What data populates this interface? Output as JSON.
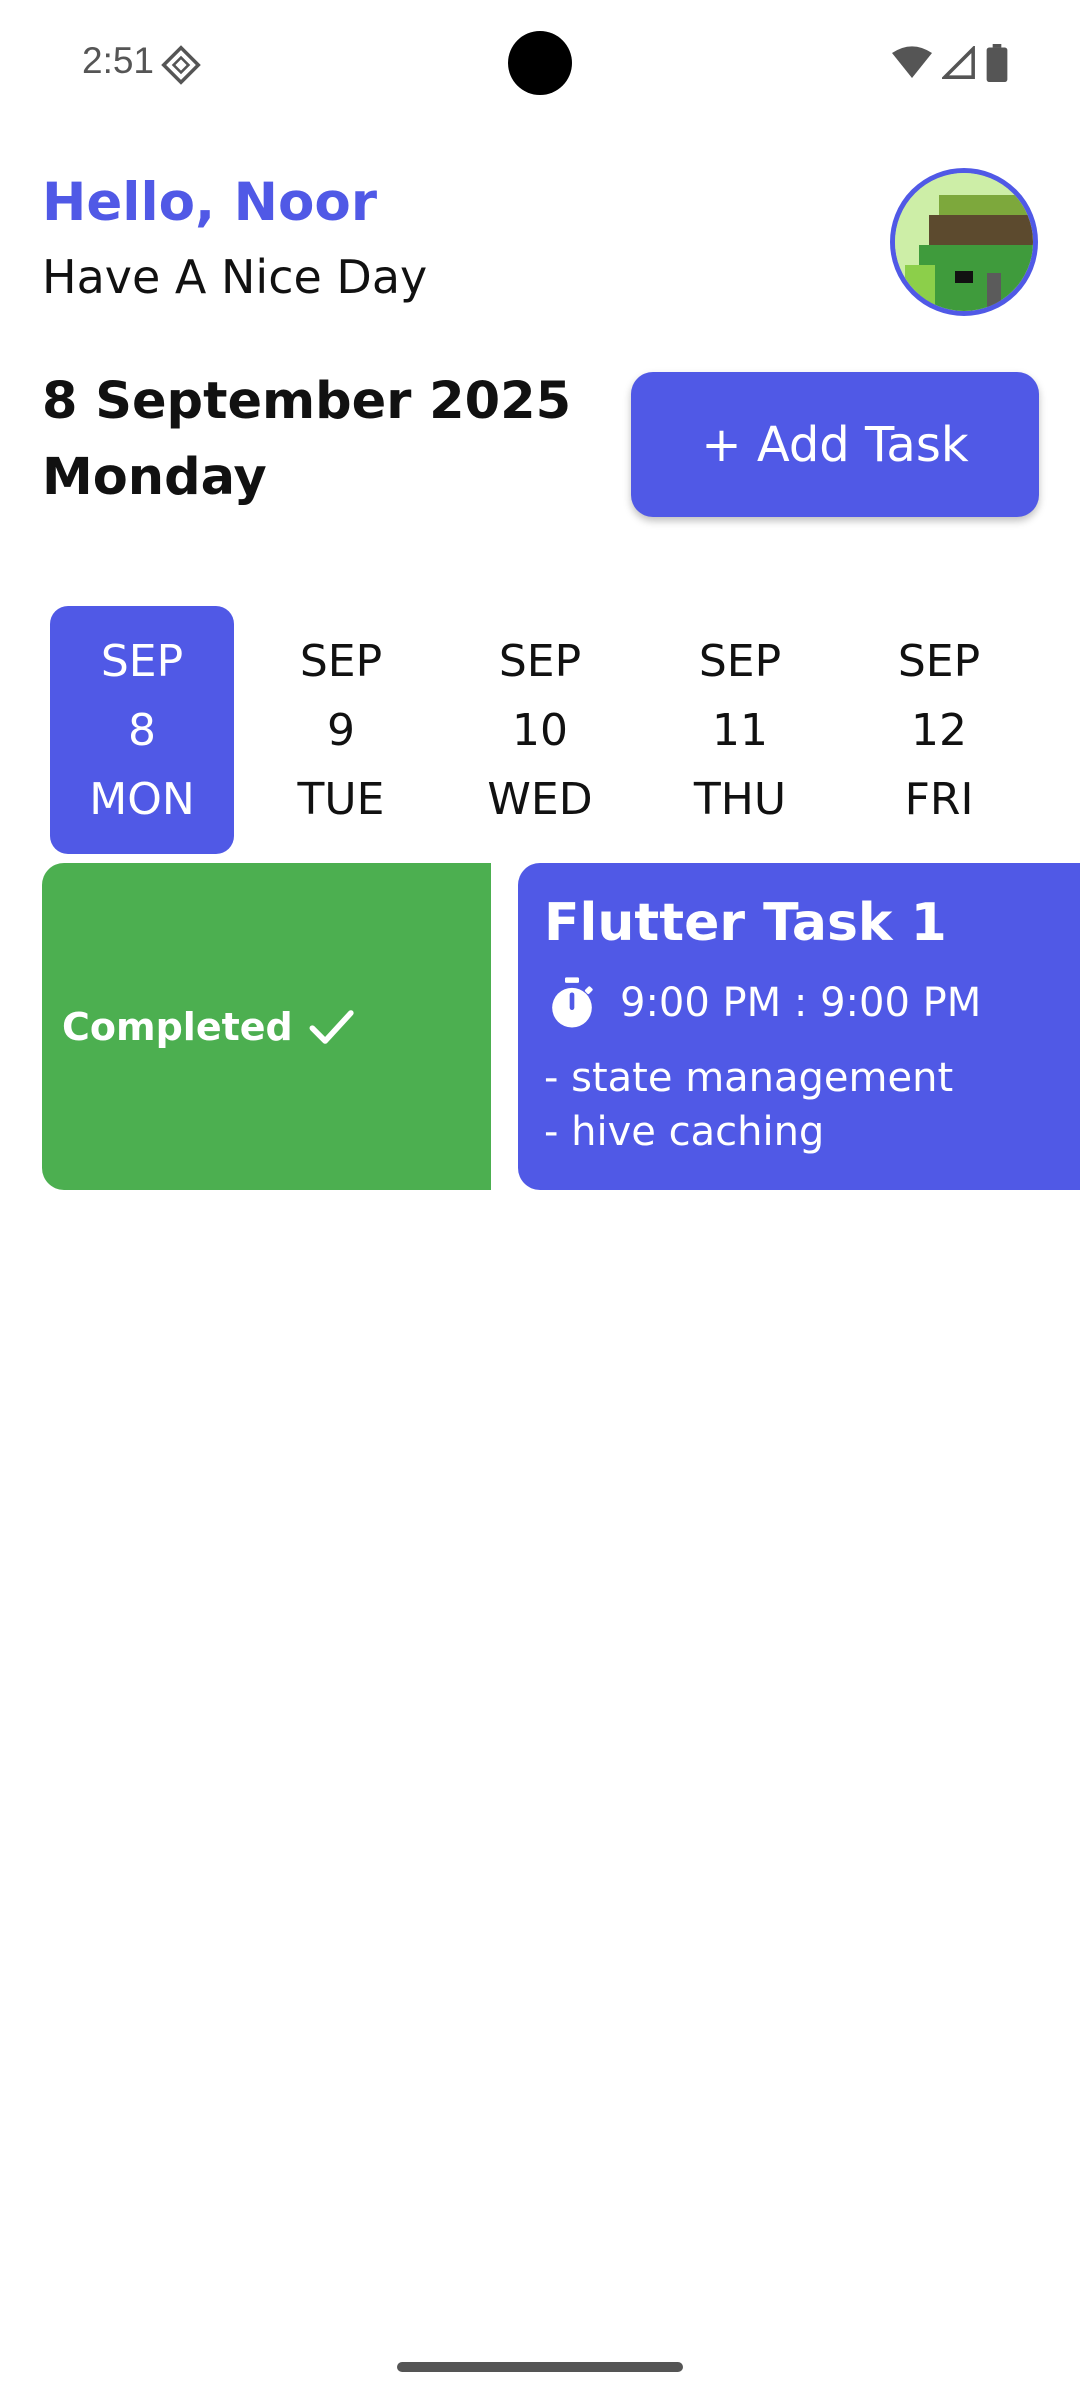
{
  "status_bar": {
    "time": "2:51",
    "icons": [
      "cast-icon",
      "wifi-icon",
      "signal-icon",
      "battery-icon"
    ]
  },
  "header": {
    "greeting": "Hello, Noor",
    "subtitle": "Have A Nice Day",
    "avatar": "avatar-image"
  },
  "date_header": {
    "date": "8 September 2025",
    "weekday": "Monday",
    "add_task_label": "+ Add Task"
  },
  "date_strip": {
    "days": [
      {
        "month": "SEP",
        "day": "8",
        "weekday": "MON",
        "selected": true
      },
      {
        "month": "SEP",
        "day": "9",
        "weekday": "TUE",
        "selected": false
      },
      {
        "month": "SEP",
        "day": "10",
        "weekday": "WED",
        "selected": false
      },
      {
        "month": "SEP",
        "day": "11",
        "weekday": "THU",
        "selected": false
      },
      {
        "month": "SEP",
        "day": "12",
        "weekday": "FRI",
        "selected": false
      }
    ]
  },
  "tasks": [
    {
      "status_label": "Completed",
      "title": "Flutter Task 1",
      "time": "9:00 PM : 9:00 PM",
      "notes": [
        "- state management",
        "- hive caching"
      ]
    }
  ],
  "colors": {
    "accent": "#5059e6",
    "completed": "#4caf50",
    "background": "#ffffff"
  }
}
